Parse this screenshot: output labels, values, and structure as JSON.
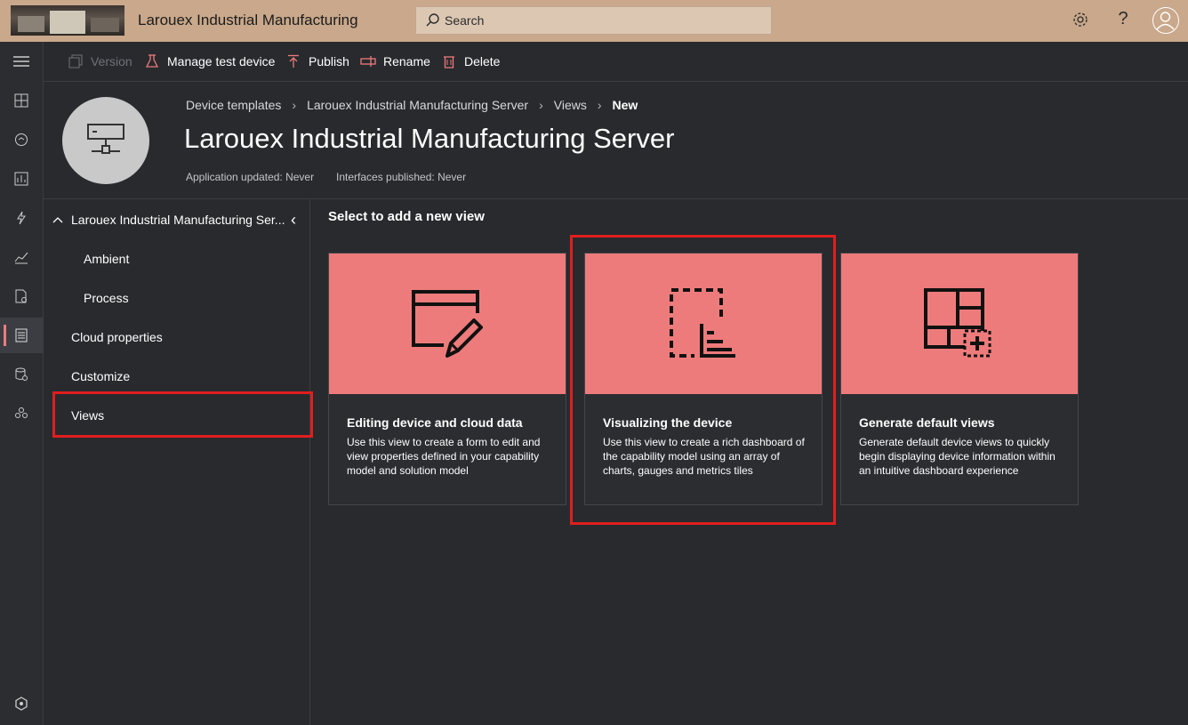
{
  "app": {
    "title": "Larouex Industrial Manufacturing",
    "search_placeholder": "Search"
  },
  "commands": [
    {
      "label": "Version",
      "icon": "copy-icon",
      "disabled": true
    },
    {
      "label": "Manage test device",
      "icon": "flask-icon",
      "disabled": false
    },
    {
      "label": "Publish",
      "icon": "upload-icon",
      "disabled": false
    },
    {
      "label": "Rename",
      "icon": "rename-icon",
      "disabled": false
    },
    {
      "label": "Delete",
      "icon": "trash-icon",
      "disabled": false
    }
  ],
  "breadcrumb": {
    "items": [
      "Device templates",
      "Larouex Industrial Manufacturing Server",
      "Views"
    ],
    "current": "New"
  },
  "header": {
    "title": "Larouex Industrial Manufacturing Server",
    "updated": "Application updated: Never",
    "published": "Interfaces published: Never"
  },
  "nav": {
    "root": "Larouex Industrial Manufacturing Ser...",
    "children": [
      "Ambient",
      "Process"
    ],
    "items": [
      "Cloud properties",
      "Customize",
      "Views"
    ]
  },
  "main": {
    "section_title": "Select to add a new view",
    "cards": [
      {
        "title": "Editing device and cloud data",
        "desc": "Use this view to create a form to edit and view properties defined in your capability model and solution model"
      },
      {
        "title": "Visualizing the device",
        "desc": "Use this view to create a rich dashboard of the capability model using an array of charts, gauges and metrics tiles"
      },
      {
        "title": "Generate default views",
        "desc": "Generate default device views to quickly begin displaying device information within an intuitive dashboard experience"
      }
    ]
  },
  "colors": {
    "topbar": "#c9a88b",
    "card_art": "#ee7b7b",
    "highlight": "#e01e1e",
    "background": "#282a2e"
  }
}
